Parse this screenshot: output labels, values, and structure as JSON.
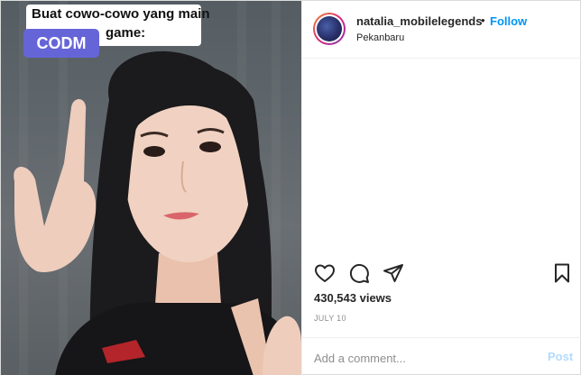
{
  "video": {
    "caption_line1": "Buat cowo-cowo yang main",
    "caption_line2": "game:",
    "badge": "CODM"
  },
  "post": {
    "username": "natalia_mobilelegends",
    "separator": "•",
    "follow_label": "Follow",
    "location": "Pekanbaru",
    "views": "430,543 views",
    "date": "JULY 10"
  },
  "comment": {
    "placeholder": "Add a comment...",
    "post_label": "Post"
  },
  "icons": {
    "like": "heart-icon",
    "comment": "comment-bubble-icon",
    "share": "paper-plane-icon",
    "save": "bookmark-icon"
  },
  "colors": {
    "link_blue": "#0095f6",
    "post_disabled": "#b3dbff",
    "badge_purple": "#6665d8"
  }
}
